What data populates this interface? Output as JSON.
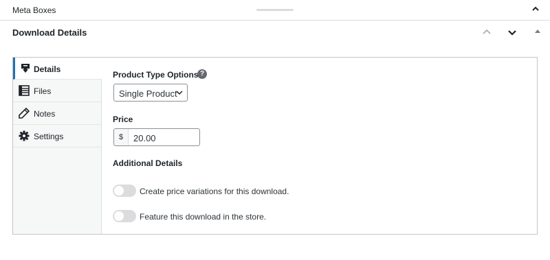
{
  "topbar": {
    "title": "Meta Boxes"
  },
  "panel": {
    "title": "Download Details"
  },
  "tabs": [
    {
      "label": "Details",
      "icon": "download-icon",
      "active": true
    },
    {
      "label": "Files",
      "icon": "list-icon",
      "active": false
    },
    {
      "label": "Notes",
      "icon": "pencil-icon",
      "active": false
    },
    {
      "label": "Settings",
      "icon": "gear-icon",
      "active": false
    }
  ],
  "details": {
    "product_type_label": "Product Type Options:",
    "help_glyph": "?",
    "product_type_value": "Single Product",
    "price_label": "Price",
    "currency_symbol": "$",
    "price_value": "20.00",
    "additional_label": "Additional Details",
    "toggles": [
      {
        "label": "Create price variations for this download.",
        "on": false
      },
      {
        "label": "Feature this download in the store.",
        "on": false
      }
    ]
  },
  "colors": {
    "accent": "#2271b1",
    "toggle_off": "#dcdcde",
    "border": "#c3c4c7"
  }
}
